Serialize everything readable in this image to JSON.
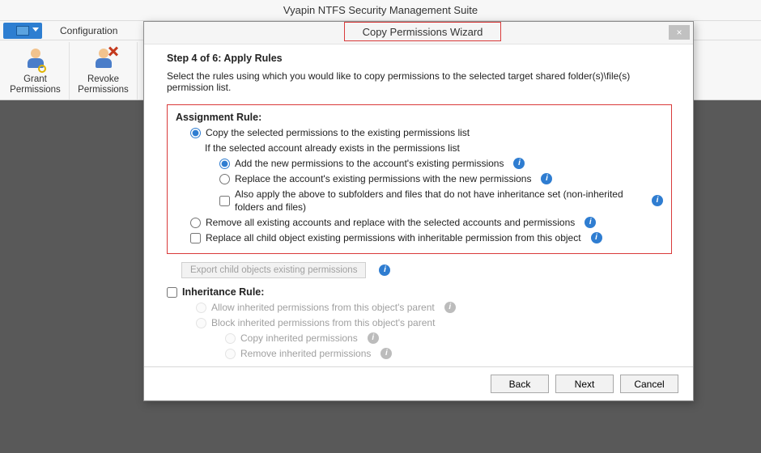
{
  "app_title": "Vyapin NTFS Security Management Suite",
  "menu": {
    "configuration": "Configuration"
  },
  "ribbon": {
    "grant_label": "Grant\nPermissions",
    "revoke_label": "Revoke\nPermissions"
  },
  "dialog": {
    "title": "Copy Permissions Wizard",
    "step_title": "Step 4 of 6: Apply Rules",
    "step_desc": "Select the rules using which you would like to copy permissions to the selected target shared folder(s)\\file(s) permission list.",
    "assignment_heading": "Assignment Rule:",
    "opt_copy_selected": "Copy the selected permissions to the existing permissions list",
    "if_exists": "If the selected account already exists in the permissions list",
    "opt_add_new": "Add the new permissions to the account's existing permissions",
    "opt_replace_account": "Replace the account's existing permissions with the new permissions",
    "opt_also_apply": "Also apply the above to subfolders and files that do not have inheritance set (non-inherited folders and files)",
    "opt_remove_all": "Remove all existing accounts and replace with the selected accounts and permissions",
    "opt_replace_child": "Replace all child object existing permissions with inheritable permission from this object",
    "export_btn": "Export child objects existing permissions",
    "inheritance_heading": "Inheritance Rule:",
    "opt_allow_inh": "Allow inherited permissions from this object's parent",
    "opt_block_inh": "Block inherited permissions from this object's parent",
    "opt_copy_inh": "Copy inherited permissions",
    "opt_remove_inh": "Remove inherited permissions",
    "btn_back": "Back",
    "btn_next": "Next",
    "btn_cancel": "Cancel",
    "info_glyph": "i",
    "close_glyph": "×"
  }
}
